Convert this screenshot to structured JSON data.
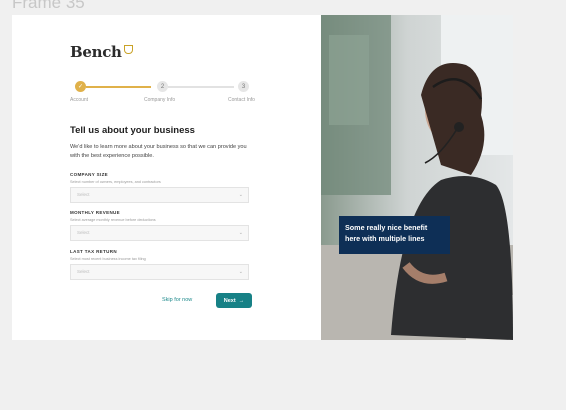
{
  "frame_label": "Frame 35",
  "brand": {
    "name": "Bench"
  },
  "stepper": {
    "steps": [
      {
        "number": "✓",
        "label": "Account",
        "state": "done"
      },
      {
        "number": "2",
        "label": "Company Info",
        "state": "current"
      },
      {
        "number": "3",
        "label": "Contact Info",
        "state": "upcoming"
      }
    ]
  },
  "form": {
    "heading": "Tell us about your business",
    "intro": "We'd like to learn more about your business so that we can provide you with the best experience possible.",
    "fields": [
      {
        "label": "Company Size",
        "help": "Select number of owners, employees, and contractors",
        "placeholder": "Select"
      },
      {
        "label": "Monthly Revenue",
        "help": "Select average monthly revenue before deductions",
        "placeholder": "Select"
      },
      {
        "label": "Last Tax Return",
        "help": "Select most recent business income tax filing",
        "placeholder": "Select"
      }
    ],
    "skip_label": "Skip for now",
    "next_label": "Next"
  },
  "hero": {
    "caption": "Some really nice benefit here with multiple lines"
  },
  "colors": {
    "accent_gold": "#e0b14a",
    "primary_teal": "#178186",
    "caption_navy": "#0e2f56"
  }
}
